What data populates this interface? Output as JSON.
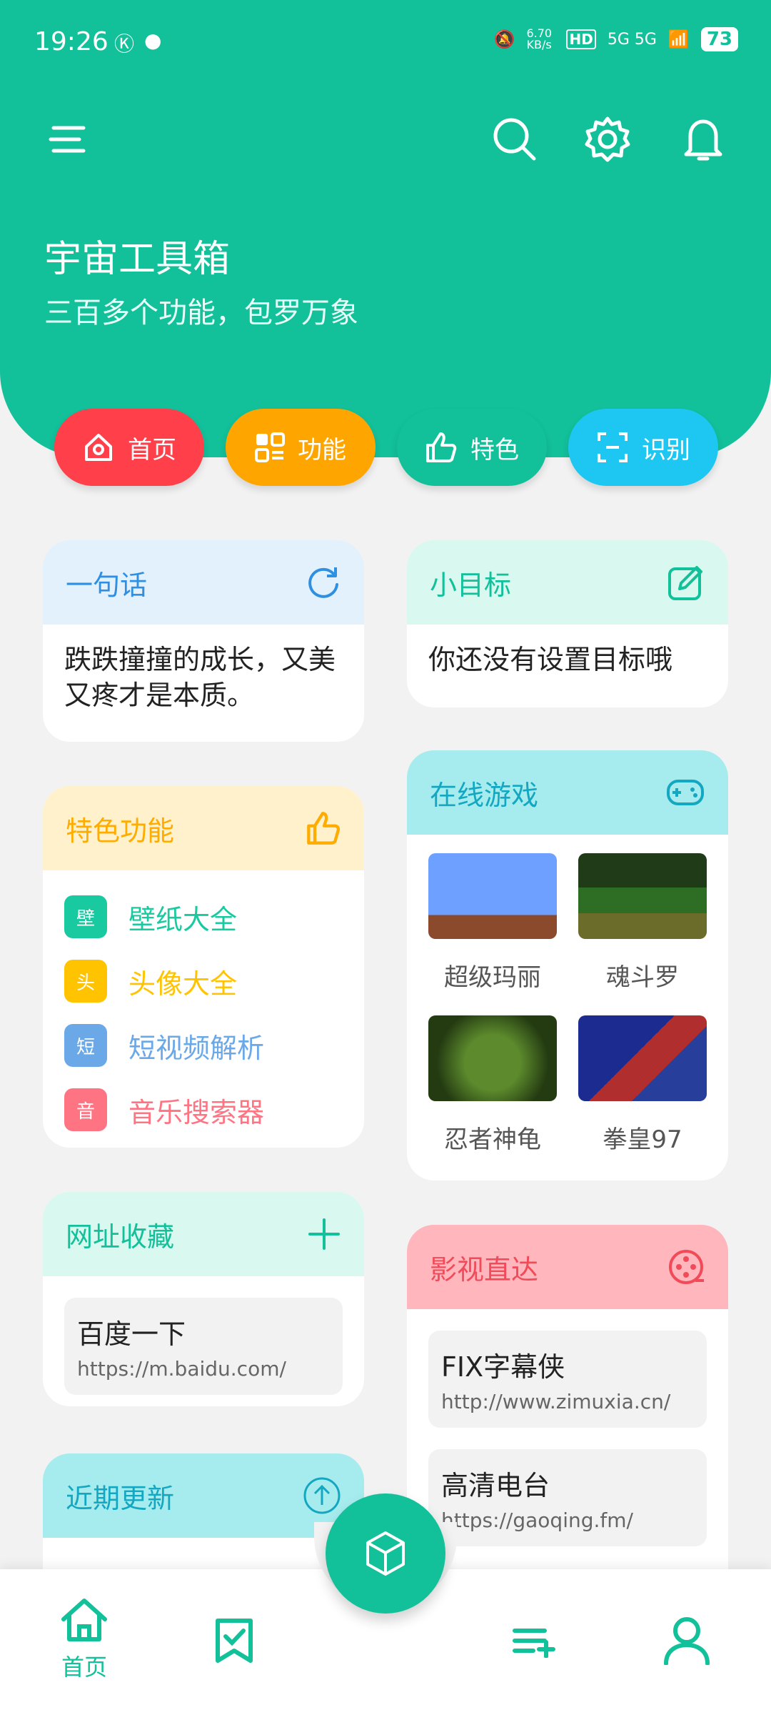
{
  "status_bar": {
    "time": "19:26",
    "net_speed": "6.70 KB/s",
    "network": "5G 5G",
    "battery": "73",
    "icons": [
      "k-icon",
      "wechat-icon",
      "mute-icon",
      "hd-icon",
      "signal-icon",
      "wifi-icon"
    ]
  },
  "header": {
    "title": "宇宙工具箱",
    "subtitle": "三百多个功能，包罗万象"
  },
  "pills": [
    {
      "label": "首页",
      "color": "#ff3f4a",
      "icon": "home-icon"
    },
    {
      "label": "功能",
      "color": "#ffa500",
      "icon": "grid-icon"
    },
    {
      "label": "特色",
      "color": "#12c09a",
      "icon": "thumbs-up-icon"
    },
    {
      "label": "识别",
      "color": "#1ec6f2",
      "icon": "scan-icon"
    }
  ],
  "cards": {
    "quote": {
      "title": "一句话",
      "text": "跌跌撞撞的成长，又美又疼才是本质。"
    },
    "goal": {
      "title": "小目标",
      "text": "你还没有设置目标哦"
    },
    "features": {
      "title": "特色功能",
      "items": [
        {
          "tag": "壁",
          "label": "壁纸大全",
          "color": "#19c9a0"
        },
        {
          "tag": "头",
          "label": "头像大全",
          "color": "#ffc300"
        },
        {
          "tag": "短",
          "label": "短视频解析",
          "color": "#6aa8e8"
        },
        {
          "tag": "音",
          "label": "音乐搜索器",
          "color": "#ff7482"
        }
      ]
    },
    "games": {
      "title": "在线游戏",
      "items": [
        "超级玛丽",
        "魂斗罗",
        "忍者神龟",
        "拳皇97"
      ]
    },
    "bookmarks": {
      "title": "网址收藏",
      "items": [
        {
          "name": "百度一下",
          "url": "https://m.baidu.com/"
        }
      ]
    },
    "video": {
      "title": "影视直达",
      "items": [
        {
          "name": "FIX字幕侠",
          "url": "http://www.zimuxia.cn/"
        },
        {
          "name": "高清电台",
          "url": "https://gaoqing.fm/"
        }
      ]
    },
    "updates": {
      "title": "近期更新"
    }
  },
  "bottom_nav": {
    "home_label": "首页"
  }
}
